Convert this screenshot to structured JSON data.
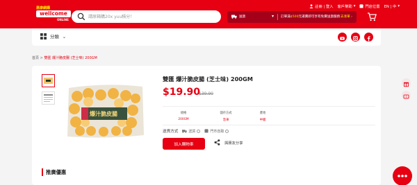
{
  "logo": {
    "top_text": "惠康網購",
    "main_text": "wellcome",
    "sub_text": "ONLINE"
  },
  "search": {
    "placeholder": "請原箱購20x yuu積分！",
    "icon": "search-icon"
  },
  "topnav": {
    "login_label": "註冊 | 登入",
    "help_label": "客戶幫助",
    "store_label": "門店位置",
    "lang_label": "EN | 中"
  },
  "promo": {
    "delivery_label": "送貨",
    "message_prefix": "訂單滿",
    "message_highlight": "$500",
    "message_suffix": "元運費即可享有免費送貨服務",
    "more_label": "去凑單"
  },
  "catbar": {
    "category_label": "分類"
  },
  "breadcrumb": {
    "home": "首頁",
    "separator": ">",
    "current": "雙匯 爆汁脆皮腸 (芝士味) 200GM"
  },
  "product": {
    "title": "雙匯 爆汁脆皮腸 (芝士味) 200GM",
    "price": "$19.90",
    "original_price": "$39.90",
    "package_text": "爆汁脆皮腸",
    "specs": [
      {
        "key": "規格",
        "value": "200GM"
      },
      {
        "key": "儲存方式",
        "value": "急凍"
      },
      {
        "key": "產地",
        "value": "中國"
      }
    ],
    "shipping_label": "送貨方式",
    "ship_options": [
      "送貨",
      "門市自取"
    ],
    "add_to_cart": "加入購物車",
    "share_label": "與朋友分享"
  },
  "recommend_title": "推廣優惠",
  "colors": {
    "brand_red": "#e60012",
    "promo_dark": "#a5001a",
    "highlight_yellow": "#ffe000"
  }
}
